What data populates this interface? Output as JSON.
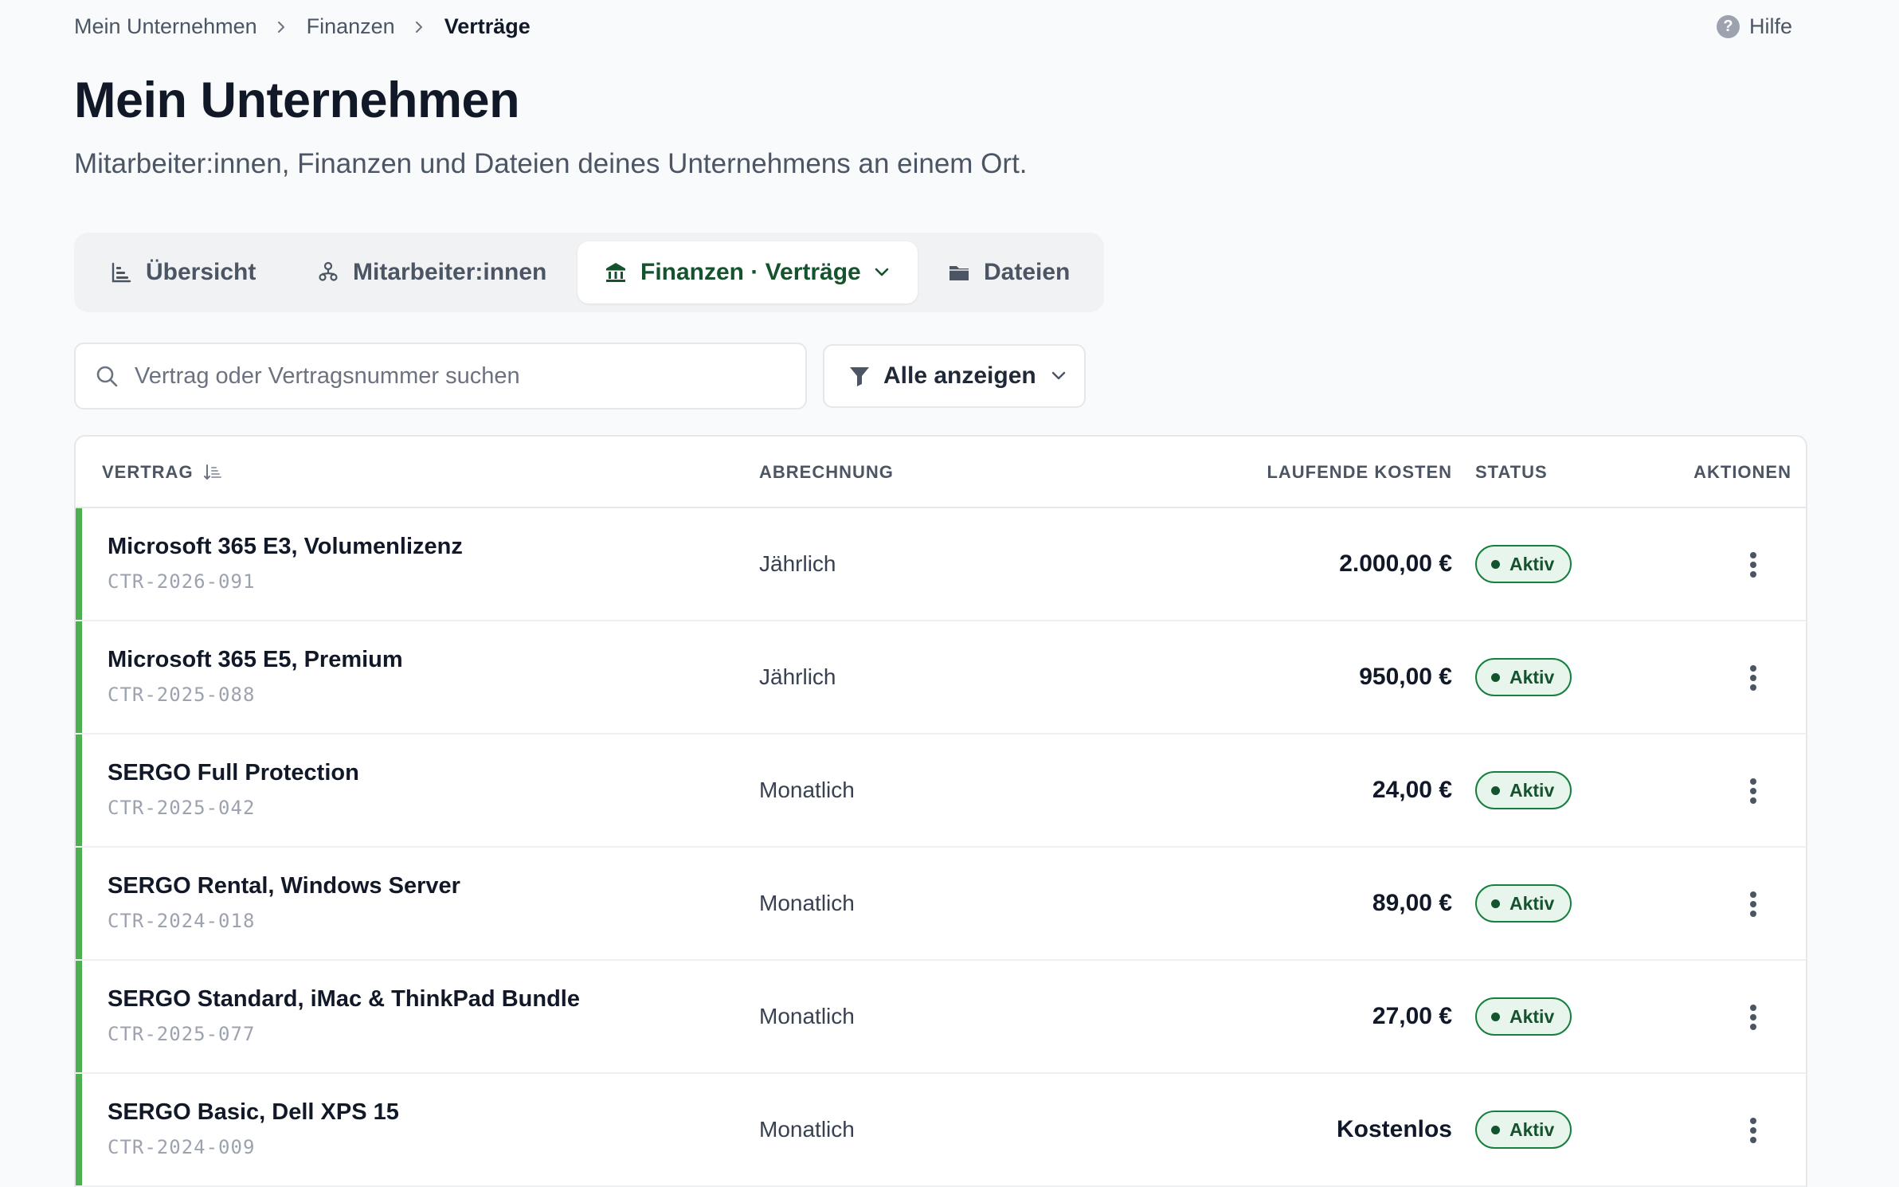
{
  "breadcrumb": {
    "items": [
      "Mein Unternehmen",
      "Finanzen"
    ],
    "current": "Verträge"
  },
  "help": {
    "label": "Hilfe"
  },
  "page": {
    "title": "Mein Unternehmen",
    "subtitle": "Mitarbeiter:innen, Finanzen und Dateien deines Unternehmens an einem Ort."
  },
  "tabs": [
    {
      "label": "Übersicht",
      "icon": "chart-bar-icon"
    },
    {
      "label": "Mitarbeiter:innen",
      "icon": "people-icon"
    },
    {
      "label": "Finanzen · Verträge",
      "icon": "bank-icon",
      "active": true
    },
    {
      "label": "Dateien",
      "icon": "folder-icon"
    }
  ],
  "search": {
    "placeholder": "Vertrag oder Vertragsnummer suchen",
    "value": ""
  },
  "filter": {
    "label": "Alle anzeigen"
  },
  "table": {
    "headers": {
      "contract": "VERTRAG",
      "billing": "ABRECHNUNG",
      "cost": "LAUFENDE KOSTEN",
      "status": "STATUS",
      "actions": "AKTIONEN"
    },
    "rows": [
      {
        "name": "Microsoft 365 E3, Volumenlizenz",
        "number": "CTR-2026-091",
        "billing": "Jährlich",
        "cost": "2.000,00 €",
        "status": "Aktiv"
      },
      {
        "name": "Microsoft 365 E5, Premium",
        "number": "CTR-2025-088",
        "billing": "Jährlich",
        "cost": "950,00 €",
        "status": "Aktiv"
      },
      {
        "name": "SERGO Full Protection",
        "number": "CTR-2025-042",
        "billing": "Monatlich",
        "cost": "24,00 €",
        "status": "Aktiv"
      },
      {
        "name": "SERGO Rental, Windows Server",
        "number": "CTR-2024-018",
        "billing": "Monatlich",
        "cost": "89,00 €",
        "status": "Aktiv"
      },
      {
        "name": "SERGO Standard, iMac & ThinkPad Bundle",
        "number": "CTR-2025-077",
        "billing": "Monatlich",
        "cost": "27,00 €",
        "status": "Aktiv"
      },
      {
        "name": "SERGO Basic, Dell XPS 15",
        "number": "CTR-2024-009",
        "billing": "Monatlich",
        "cost": "Kostenlos",
        "status": "Aktiv"
      }
    ]
  },
  "colors": {
    "accent": "#14532d",
    "status_active_border": "#15803d",
    "status_active_bg": "#e8f5ec",
    "row_bar": "#4caf50"
  }
}
